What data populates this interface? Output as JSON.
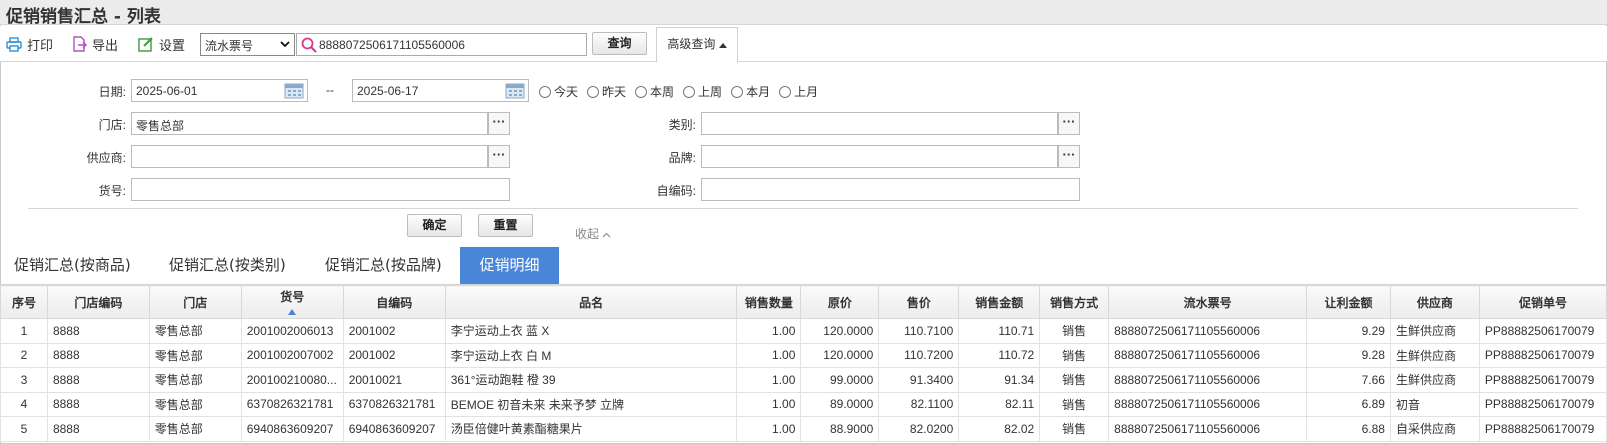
{
  "title": "促销销售汇总 - 列表",
  "toolbar": {
    "print": "打印",
    "export": "导出",
    "settings": "设置",
    "select_value": "流水票号",
    "search_value": "8888072506171105560006",
    "query": "查询",
    "advanced": "高级查询"
  },
  "form": {
    "date_label": "日期:",
    "date_from": "2025-06-01",
    "date_sep": "--",
    "date_to": "2025-06-17",
    "ranges": [
      "今天",
      "昨天",
      "本周",
      "上周",
      "本月",
      "上月"
    ],
    "store_label": "门店:",
    "store_value": "零售总部",
    "supplier_label": "供应商:",
    "supplier_value": "",
    "itemno_label": "货号:",
    "itemno_value": "",
    "category_label": "类别:",
    "category_value": "",
    "brand_label": "品牌:",
    "brand_value": "",
    "selfcode_label": "自编码:",
    "selfcode_value": "",
    "ok": "确定",
    "reset": "重置",
    "collapse": "收起"
  },
  "tabs": [
    "促销汇总(按商品)",
    "促销汇总(按类别)",
    "促销汇总(按品牌)",
    "促销明细"
  ],
  "table": {
    "headers": [
      "序号",
      "门店编码",
      "门店",
      "货号",
      "自编码",
      "品名",
      "销售数量",
      "原价",
      "售价",
      "销售金额",
      "销售方式",
      "流水票号",
      "让利金额",
      "供应商",
      "促销单号"
    ],
    "rows": [
      [
        "1",
        "8888",
        "零售总部",
        "2001002006013",
        "2001002",
        "李宁运动上衣 蓝 X",
        "1.00",
        "120.0000",
        "110.7100",
        "110.71",
        "销售",
        "8888072506171105560006",
        "9.29",
        "生鲜供应商",
        "PP88882506170079"
      ],
      [
        "2",
        "8888",
        "零售总部",
        "2001002007002",
        "2001002",
        "李宁运动上衣 白 M",
        "1.00",
        "120.0000",
        "110.7200",
        "110.72",
        "销售",
        "8888072506171105560006",
        "9.28",
        "生鲜供应商",
        "PP88882506170079"
      ],
      [
        "3",
        "8888",
        "零售总部",
        "200100210080...",
        "20010021",
        "361°运动跑鞋 橙 39",
        "1.00",
        "99.0000",
        "91.3400",
        "91.34",
        "销售",
        "8888072506171105560006",
        "7.66",
        "生鲜供应商",
        "PP88882506170079"
      ],
      [
        "4",
        "8888",
        "零售总部",
        "6370826321781",
        "6370826321781",
        "BEMOE 初音未来 未来予梦 立牌",
        "1.00",
        "89.0000",
        "82.1100",
        "82.11",
        "销售",
        "8888072506171105560006",
        "6.89",
        "初音",
        "PP88882506170079"
      ],
      [
        "5",
        "8888",
        "零售总部",
        "6940863609207",
        "6940863609207",
        "汤臣倍健叶黄素酯糖果片",
        "1.00",
        "88.9000",
        "82.0200",
        "82.02",
        "销售",
        "8888072506171105560006",
        "6.88",
        "自采供应商",
        "PP88882506170079"
      ]
    ]
  },
  "colors": {
    "accent": "#4a86d8",
    "icon_blue": "#2f8fd6",
    "icon_pink": "#b54fc7",
    "icon_green": "#3d9a3d",
    "search_red": "#d23c8a"
  }
}
